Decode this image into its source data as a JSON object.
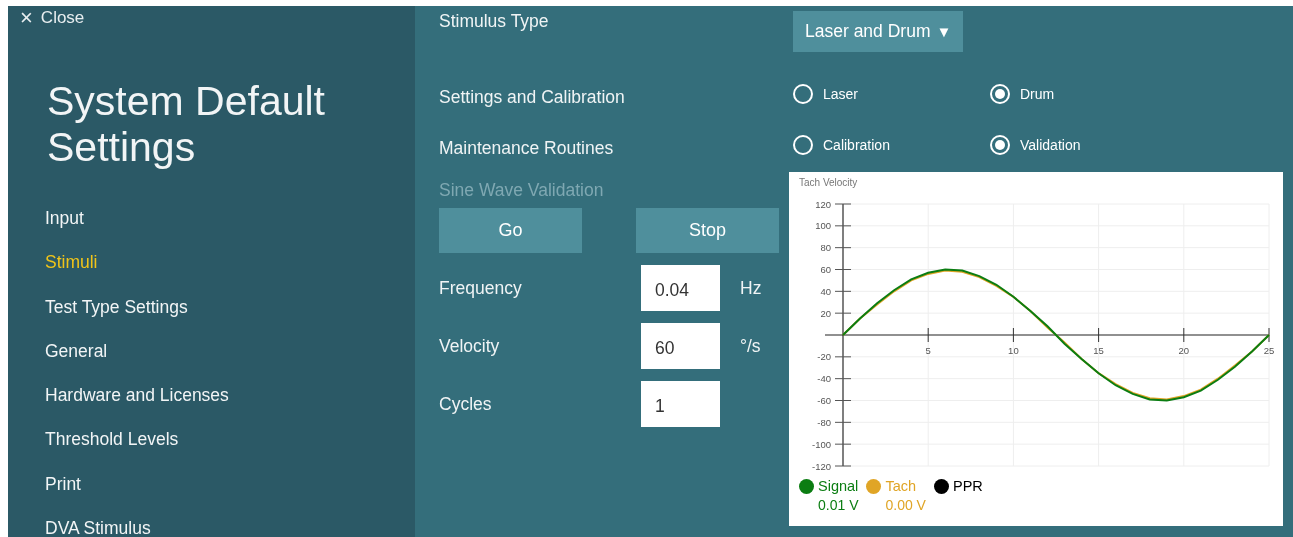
{
  "sidebar": {
    "close": {
      "icon": "×",
      "label": "Close"
    },
    "title": "System Default Settings",
    "items": [
      {
        "label": "Input",
        "selected": false
      },
      {
        "label": "Stimuli",
        "selected": true
      },
      {
        "label": "Test Type Settings",
        "selected": false
      },
      {
        "label": "General",
        "selected": false
      },
      {
        "label": "Hardware and Licenses",
        "selected": false
      },
      {
        "label": "Threshold Levels",
        "selected": false
      },
      {
        "label": "Print",
        "selected": false
      },
      {
        "label": "DVA Stimulus",
        "selected": false
      }
    ]
  },
  "stimulus_type": {
    "label": "Stimulus Type",
    "value": "Laser and Drum",
    "caret": "▼"
  },
  "option_rows": [
    {
      "label": "Settings and Calibration",
      "options": [
        {
          "label": "Laser",
          "selected": false
        },
        {
          "label": "Drum",
          "selected": true
        }
      ]
    },
    {
      "label": "Maintenance Routines",
      "options": [
        {
          "label": "Calibration",
          "selected": false
        },
        {
          "label": "Validation",
          "selected": true
        }
      ]
    }
  ],
  "validation": {
    "title": "Sine Wave Validation",
    "buttons": [
      "Go",
      "Stop"
    ],
    "fields": [
      {
        "label": "Frequency",
        "value": "0.04",
        "unit": "Hz"
      },
      {
        "label": "Velocity",
        "value": "60",
        "unit": "°/s"
      },
      {
        "label": "Cycles",
        "value": "1"
      }
    ]
  },
  "chart": {
    "chart_data": {
      "type": "line",
      "title": "Tach Velocity",
      "grid": true,
      "x": [
        0,
        1,
        2,
        3,
        4,
        5,
        6,
        7,
        8,
        9,
        10,
        11,
        12,
        13,
        14,
        15,
        16,
        17,
        18,
        19,
        20,
        21,
        22,
        23,
        24,
        25
      ],
      "series": [
        {
          "name": "Signal",
          "color": "#0b7d12",
          "values": [
            0,
            15,
            29,
            41,
            51,
            57,
            60,
            59,
            54,
            46,
            35,
            22,
            8,
            -8,
            -22,
            -35,
            -46,
            -54,
            -59,
            -60,
            -57,
            -51,
            -41,
            -29,
            -15,
            0
          ]
        },
        {
          "name": "Tach",
          "color": "#e0a526",
          "values": [
            0,
            15,
            28,
            40,
            50,
            56,
            59,
            58,
            53,
            45,
            35,
            22,
            7,
            -7,
            -22,
            -35,
            -45,
            -53,
            -58,
            -59,
            -56,
            -50,
            -40,
            -28,
            -15,
            0
          ]
        },
        {
          "name": "PPR",
          "color": "#000000",
          "values": [
            null,
            null,
            null,
            null,
            null,
            null,
            null,
            null,
            null,
            null,
            null,
            null,
            null,
            null,
            null,
            null,
            null,
            null,
            null,
            null,
            null,
            null,
            null,
            null,
            null,
            null
          ]
        }
      ],
      "xlim": [
        0,
        25
      ],
      "ylim": [
        -120,
        120
      ],
      "xticks": [
        5,
        10,
        15,
        20,
        25
      ],
      "yticks": [
        -120,
        -100,
        -80,
        -60,
        -40,
        -20,
        20,
        40,
        60,
        80,
        100,
        120
      ]
    },
    "readings": [
      "0.01 V",
      "0.00 V"
    ]
  }
}
